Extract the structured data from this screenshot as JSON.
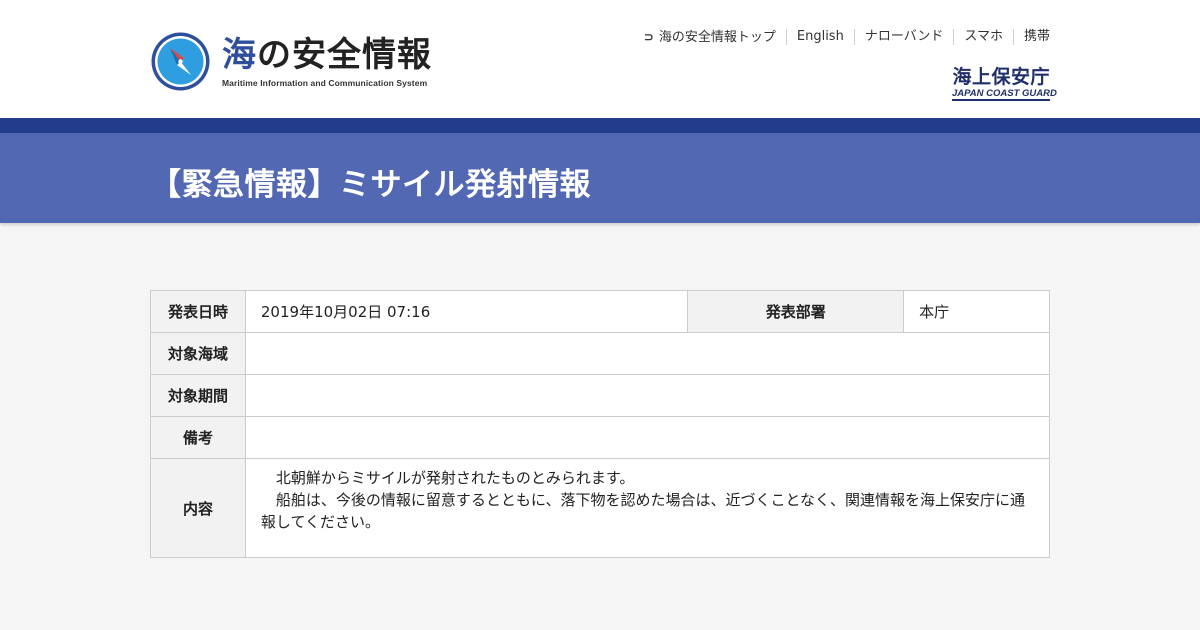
{
  "site": {
    "logo_title_accent": "海",
    "logo_title_rest": "の安全情報",
    "logo_subtitle": "Maritime Information and Communication System",
    "org_kanji": "海上保安庁",
    "org_english": "JAPAN COAST GUARD"
  },
  "nav": {
    "arrow_icon": "⊃",
    "items": [
      "海の安全情報トップ",
      "English",
      "ナローバンド",
      "スマホ",
      "携帯"
    ]
  },
  "page": {
    "title": "【緊急情報】ミサイル発射情報"
  },
  "table": {
    "issued_label": "発表日時",
    "issued_value": "2019年10月02日 07:16",
    "dept_label": "発表部署",
    "dept_value": "本庁",
    "area_label": "対象海域",
    "area_value": "",
    "period_label": "対象期間",
    "period_value": "",
    "remarks_label": "備考",
    "remarks_value": "",
    "content_label": "内容",
    "content_line1": "　北朝鮮からミサイルが発射されたものとみられます。",
    "content_line2": "　船舶は、今後の情報に留意するとともに、落下物を認めた場合は、近づくことなく、関連情報を海上保安庁に通報してください。"
  },
  "colors": {
    "band_dark": "#233c8b",
    "band_main": "#5268b3",
    "brand_navy": "#1f2f6b",
    "logo_ring": "#2e4f9c",
    "compass_red": "#e4463b",
    "compass_blue": "#2f9ee0"
  }
}
